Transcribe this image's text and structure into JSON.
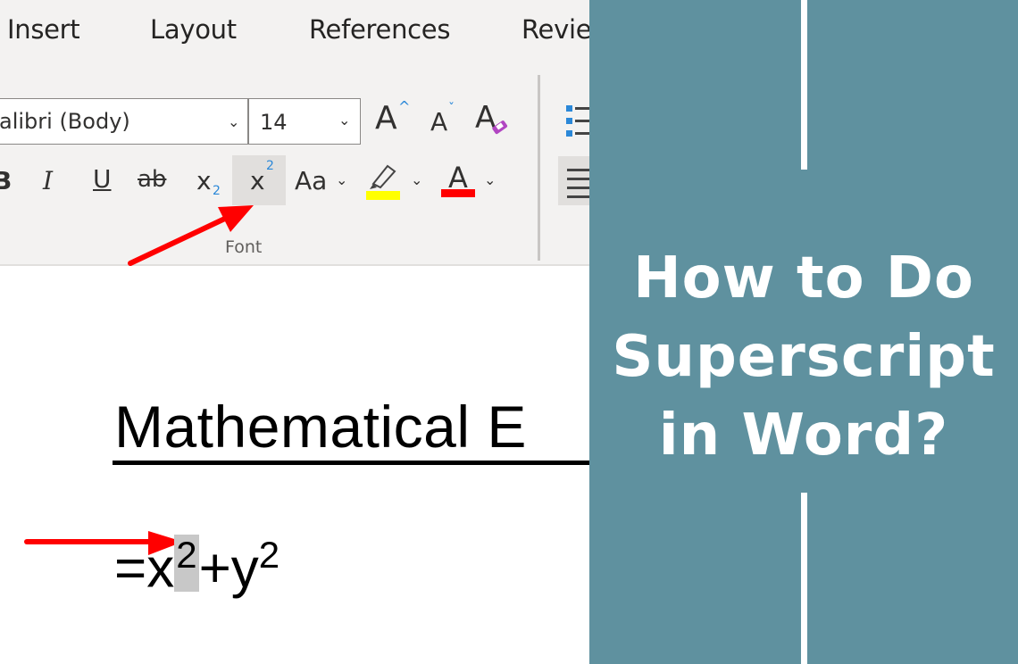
{
  "ribbon": {
    "tabs": [
      "Insert",
      "Layout",
      "References",
      "Revie"
    ],
    "font_name": "alibri (Body)",
    "font_size": "14",
    "group_label": "Font",
    "buttons": {
      "bold": "B",
      "italic": "I",
      "underline": "U",
      "strikethrough": "ab",
      "subscript_base": "x",
      "subscript_index": "2",
      "superscript_base": "x",
      "superscript_index": "2",
      "grow_font": "A",
      "shrink_font": "A",
      "clear_format": "A",
      "change_case": "Aa",
      "font_color_glyph": "A"
    },
    "highlight_color": "#ffff00",
    "font_color": "#ff0000",
    "accent_blue": "#2b88d8"
  },
  "document": {
    "heading": "Mathematical E",
    "equation_prefix": "=x",
    "equation_selected_sup": "2",
    "equation_middle": "+y",
    "equation_sup": "2"
  },
  "panel": {
    "title_line1": "How to Do",
    "title_line2": "Superscript",
    "title_line3": "in Word?",
    "background": "#5f919f"
  }
}
